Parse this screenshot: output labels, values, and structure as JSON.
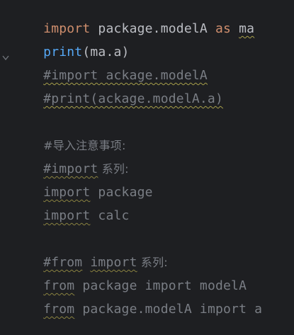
{
  "editor": {
    "lines": [
      {
        "parts": [
          "import",
          " package.modelA ",
          "as",
          " ",
          "ma"
        ]
      },
      {
        "parts": [
          "print",
          "(ma.a)"
        ]
      },
      {
        "text": "#import ackage.modelA"
      },
      {
        "text": "#print(ackage.modelA.a)"
      },
      {
        "text": ""
      },
      {
        "text": "#导入注意事项:"
      },
      {
        "parts": [
          "#import",
          " 系列:"
        ]
      },
      {
        "parts": [
          "import",
          " package"
        ]
      },
      {
        "parts": [
          "import",
          " calc"
        ]
      },
      {
        "text": ""
      },
      {
        "parts": [
          "#from",
          " ",
          "import",
          " 系列:"
        ]
      },
      {
        "parts": [
          "from",
          " package import modelA"
        ]
      },
      {
        "parts": [
          "from",
          " package.modelA import a"
        ]
      }
    ]
  },
  "icons": {
    "fold": "fold-chevron-icon"
  },
  "colors": {
    "background": "#1e1f22",
    "keyword": "#cf8e6d",
    "function": "#56a8f5",
    "identifier": "#bcbec4",
    "comment": "#7a7e85",
    "warning_underline": "#a8a04a"
  }
}
